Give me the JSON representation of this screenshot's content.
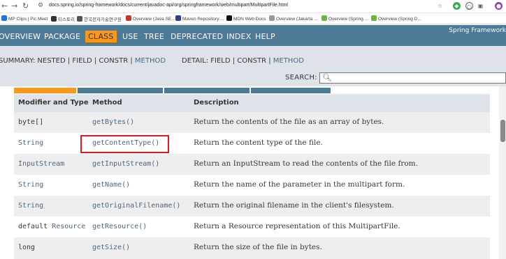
{
  "browser": {
    "url": "docs.spring.io/spring-framework/docs/current/javadoc-api/org/springframework/web/multipart/MultipartFile.html",
    "bookmarks": [
      "MP Clips | Pic Meet",
      "티스토리",
      "한국전자기술연구원",
      "Overview (Java SE...",
      "Maven Repository:...",
      "MDN Web Docs",
      "Overview (Jakarta ...",
      "Overview (Spring ...",
      "Overview (Spring D..."
    ]
  },
  "topnav": {
    "items": [
      "OVERVIEW",
      "PACKAGE",
      "CLASS",
      "USE",
      "TREE",
      "DEPRECATED",
      "INDEX",
      "HELP"
    ],
    "brand": "Spring Framework"
  },
  "subnav": {
    "summary_prefix": "SUMMARY: NESTED | FIELD | CONSTR | ",
    "summary_method": "METHOD",
    "detail_prefix": "DETAIL: FIELD | CONSTR | ",
    "detail_method": "METHOD",
    "search_label": "SEARCH:",
    "search_placeholder": ""
  },
  "table": {
    "headers": [
      "Modifier and Type",
      "Method",
      "Description"
    ],
    "rows": [
      {
        "type_prefix": "",
        "type": "byte[]",
        "type_link": false,
        "method": "getBytes()",
        "desc": "Return the contents of the file as an array of bytes."
      },
      {
        "type_prefix": "",
        "type": "String",
        "type_link": true,
        "method": "getContentType()",
        "desc": "Return the content type of the file."
      },
      {
        "type_prefix": "",
        "type": "InputStream",
        "type_link": true,
        "method": "getInputStream()",
        "desc": "Return an InputStream to read the contents of the file from."
      },
      {
        "type_prefix": "",
        "type": "String",
        "type_link": true,
        "method": "getName()",
        "desc": "Return the name of the parameter in the multipart form."
      },
      {
        "type_prefix": "",
        "type": "String",
        "type_link": true,
        "method": "getOriginalFilename()",
        "desc": "Return the original filename in the client's filesystem."
      },
      {
        "type_prefix": "default ",
        "type": "Resource",
        "type_link": true,
        "method": "getResource()",
        "desc": "Return a Resource representation of this MultipartFile."
      },
      {
        "type_prefix": "",
        "type": "long",
        "type_link": false,
        "method": "getSize()",
        "desc": "Return the size of the file in bytes."
      }
    ]
  },
  "colors": {
    "nav_blue": "#4d7a97",
    "active_orange": "#f8981d",
    "link_blue": "#4a6782",
    "highlight_red": "#e0191f"
  }
}
